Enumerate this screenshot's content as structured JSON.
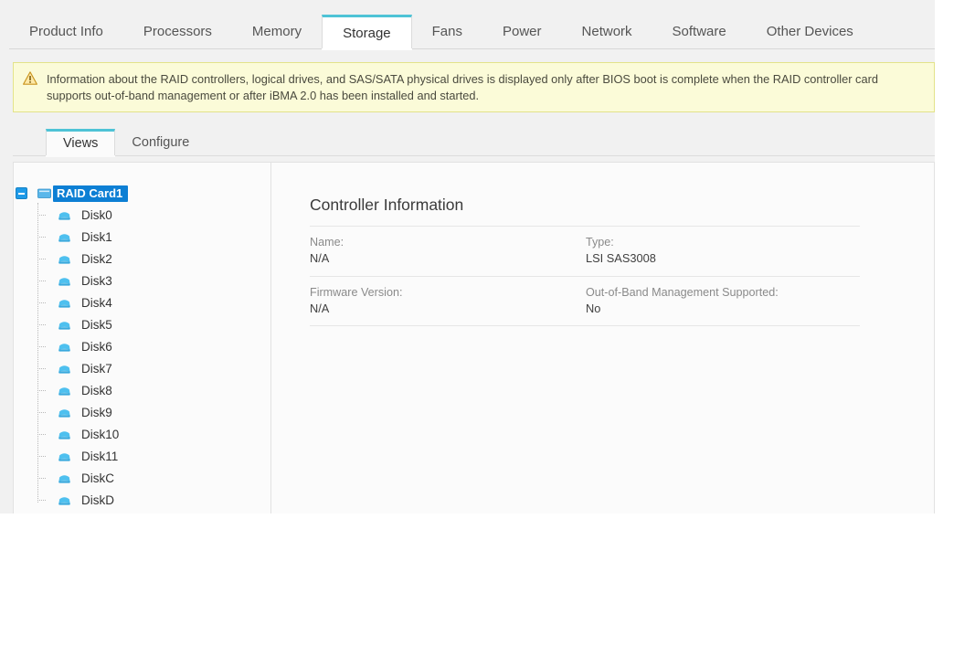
{
  "main_tabs": [
    {
      "label": "Product Info",
      "active": false
    },
    {
      "label": "Processors",
      "active": false
    },
    {
      "label": "Memory",
      "active": false
    },
    {
      "label": "Storage",
      "active": true
    },
    {
      "label": "Fans",
      "active": false
    },
    {
      "label": "Power",
      "active": false
    },
    {
      "label": "Network",
      "active": false
    },
    {
      "label": "Software",
      "active": false
    },
    {
      "label": "Other Devices",
      "active": false
    }
  ],
  "notice": {
    "icon": "warning-triangle-icon",
    "text": "Information about the RAID controllers, logical drives, and SAS/SATA physical drives is displayed only after BIOS boot is complete when the RAID controller card supports out-of-band management or after iBMA 2.0 has been installed and started.",
    "background_color": "#fbfbd8",
    "border_color": "#e3e38a",
    "icon_color": "#e8a317"
  },
  "sub_tabs": [
    {
      "label": "Views",
      "active": true
    },
    {
      "label": "Configure",
      "active": false
    }
  ],
  "tree": {
    "root": {
      "label": "RAID Card1",
      "icon": "raid-card-icon",
      "selected": true,
      "expanded": true,
      "selected_background": "#0d7fd4",
      "toggle_color": "#1e9ae8"
    },
    "children": [
      {
        "label": "Disk0",
        "icon": "disk-icon"
      },
      {
        "label": "Disk1",
        "icon": "disk-icon"
      },
      {
        "label": "Disk2",
        "icon": "disk-icon"
      },
      {
        "label": "Disk3",
        "icon": "disk-icon"
      },
      {
        "label": "Disk4",
        "icon": "disk-icon"
      },
      {
        "label": "Disk5",
        "icon": "disk-icon"
      },
      {
        "label": "Disk6",
        "icon": "disk-icon"
      },
      {
        "label": "Disk7",
        "icon": "disk-icon"
      },
      {
        "label": "Disk8",
        "icon": "disk-icon"
      },
      {
        "label": "Disk9",
        "icon": "disk-icon"
      },
      {
        "label": "Disk10",
        "icon": "disk-icon"
      },
      {
        "label": "Disk11",
        "icon": "disk-icon"
      },
      {
        "label": "DiskC",
        "icon": "disk-icon"
      },
      {
        "label": "DiskD",
        "icon": "disk-icon"
      }
    ],
    "disk_icon_color": "#4ec0ef"
  },
  "controller_info": {
    "title": "Controller Information",
    "rows": [
      {
        "left": {
          "label": "Name:",
          "value": "N/A"
        },
        "right": {
          "label": "Type:",
          "value": "LSI SAS3008"
        }
      },
      {
        "left": {
          "label": "Firmware Version:",
          "value": "N/A"
        },
        "right": {
          "label": "Out-of-Band Management Supported:",
          "value": "No"
        }
      }
    ]
  }
}
